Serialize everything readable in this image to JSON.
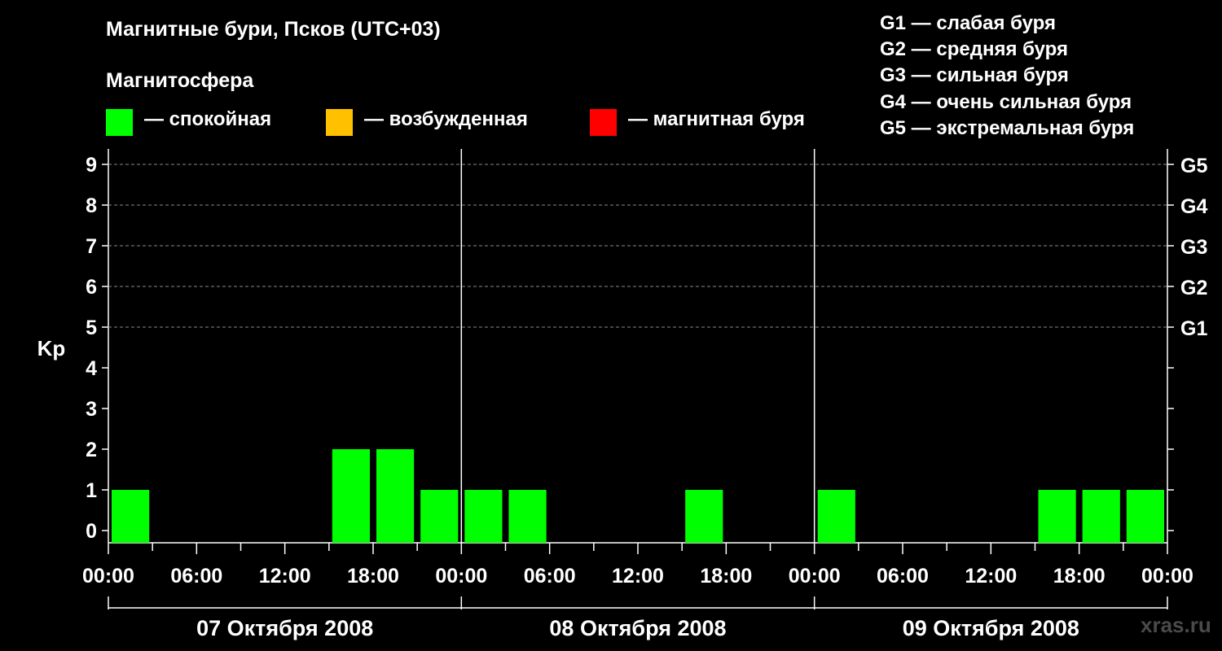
{
  "title": "Магнитные бури, Псков (UTC+03)",
  "subtitle": "Магнитосфера",
  "legend": [
    {
      "label": "— спокойная",
      "color": "#00ff00"
    },
    {
      "label": "— возбужденная",
      "color": "#ffc000"
    },
    {
      "label": "— магнитная буря",
      "color": "#ff0000"
    }
  ],
  "g_legend": [
    "G1 — слабая буря",
    "G2 — средняя буря",
    "G3 — сильная буря",
    "G4 — очень сильная буря",
    "G5 — экстремальная буря"
  ],
  "watermark": "xras.ru",
  "chart_data": {
    "type": "bar",
    "ylabel": "Kp",
    "ylim": [
      0,
      9
    ],
    "yticks": [
      "0",
      "1",
      "2",
      "3",
      "4",
      "5",
      "6",
      "7",
      "8",
      "9"
    ],
    "right_ticks": [
      {
        "kp": 5,
        "label": "G1"
      },
      {
        "kp": 6,
        "label": "G2"
      },
      {
        "kp": 7,
        "label": "G3"
      },
      {
        "kp": 8,
        "label": "G4"
      },
      {
        "kp": 9,
        "label": "G5"
      }
    ],
    "xtick_labels": [
      "00:00",
      "06:00",
      "12:00",
      "18:00",
      "00:00",
      "06:00",
      "12:00",
      "18:00",
      "00:00",
      "06:00",
      "12:00",
      "18:00",
      "00:00"
    ],
    "days": [
      "07 Октября 2008",
      "08 Октября 2008",
      "09 Октября 2008"
    ],
    "interval_hours": 3,
    "grid": "dashed at Kp 5-9",
    "series": [
      {
        "values": [
          1,
          0,
          0,
          0,
          0,
          2,
          2,
          1,
          1,
          1,
          0,
          0,
          0,
          1,
          0,
          0,
          1,
          0,
          0,
          0,
          0,
          1,
          1,
          1
        ]
      }
    ]
  }
}
